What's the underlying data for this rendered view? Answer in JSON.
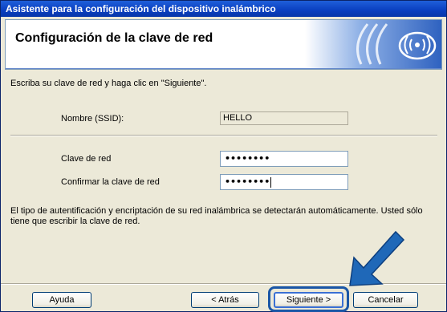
{
  "window": {
    "title": "Asistente para la configuración del dispositivo inalámbrico"
  },
  "header": {
    "title": "Configuración de la clave de red"
  },
  "form": {
    "instruction": "Escriba su clave de red y haga clic en \"Siguiente\".",
    "ssid_label": "Nombre (SSID):",
    "ssid_value": "HELLO",
    "key_label": "Clave de red",
    "key_value": "••••••••",
    "confirm_label": "Confirmar la clave de red",
    "confirm_value": "••••••••",
    "info": "El tipo de autentificación y encriptación de su red inalámbrica se detectarán automáticamente. Usted sólo tiene que escribir la clave de red."
  },
  "buttons": {
    "help": "Ayuda",
    "back": "< Atrás",
    "next": "Siguiente >",
    "cancel": "Cancelar"
  },
  "colors": {
    "titlebar": "#0a3fc0",
    "dialog_bg": "#ece9d8",
    "highlight_ring": "#1a56a6",
    "arrow": "#1f68b8"
  },
  "icons": {
    "header_logo": "wireless-signal-icon",
    "pointer": "arrow-pointer-icon"
  }
}
